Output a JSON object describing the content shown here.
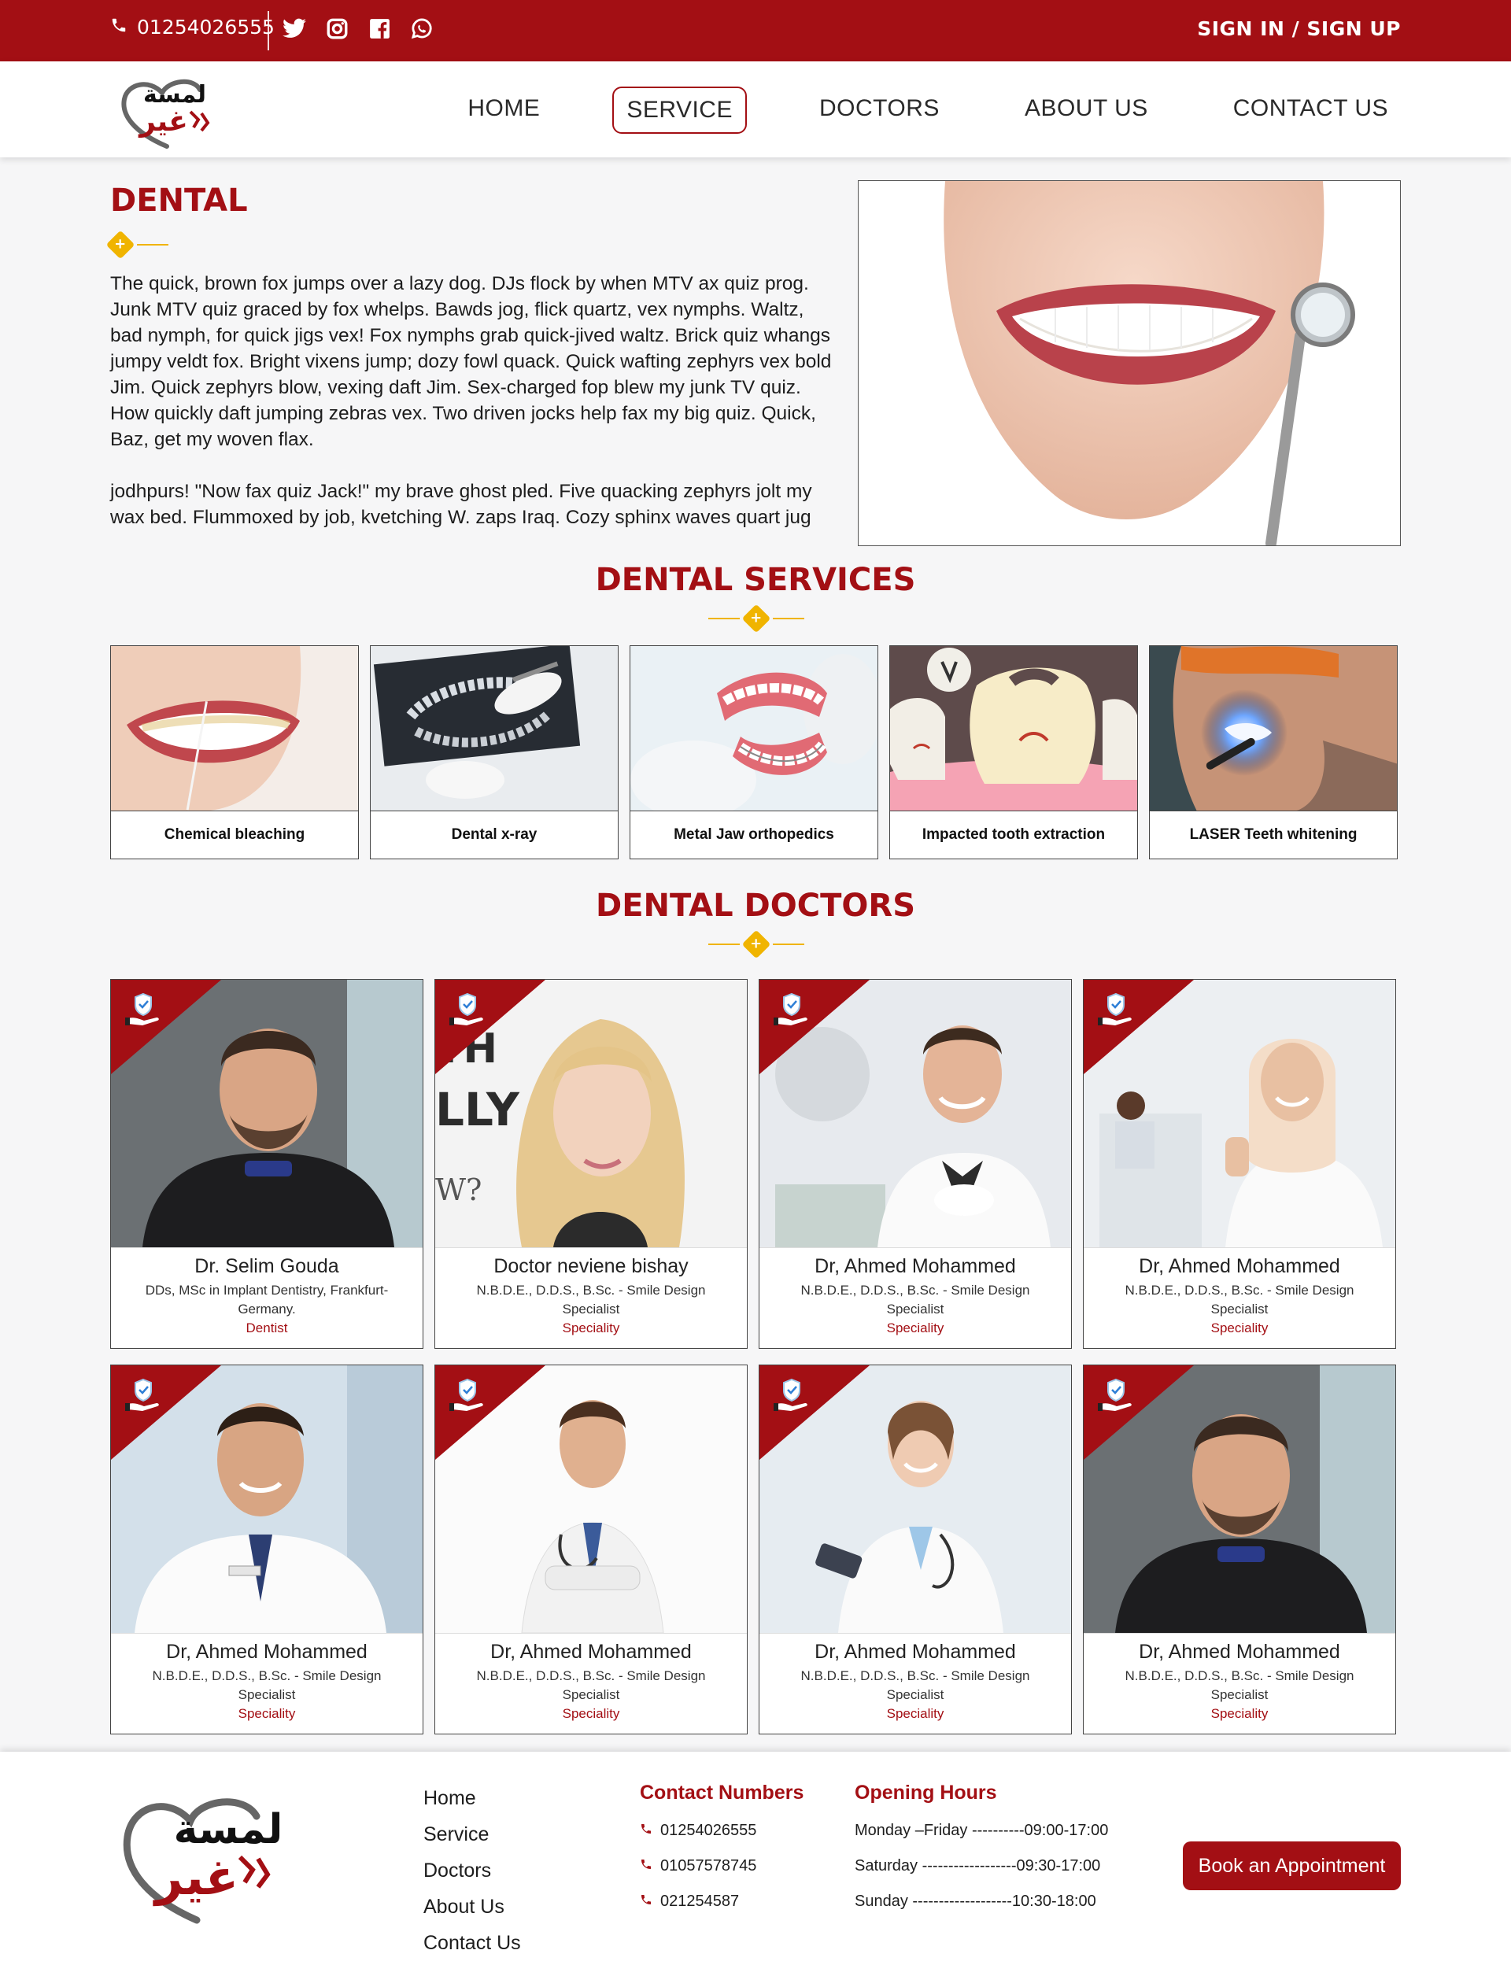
{
  "topbar": {
    "phone": "01254026555",
    "auth_label": "SIGN IN / SIGN UP",
    "socials": [
      "twitter-icon",
      "instagram-icon",
      "facebook-icon",
      "whatsapp-icon"
    ]
  },
  "nav": {
    "items": [
      {
        "label": "HOME",
        "active": false
      },
      {
        "label": "SERVICE",
        "active": true
      },
      {
        "label": "DOCTORS",
        "active": false
      },
      {
        "label": "ABOUT US",
        "active": false
      },
      {
        "label": "CONTACT US",
        "active": false
      }
    ]
  },
  "logo": {
    "text_line1": "لمسة",
    "text_line2": "غير"
  },
  "intro": {
    "title": "DENTAL",
    "paragraph1": "The quick, brown fox jumps over a lazy dog. DJs flock by when MTV ax quiz prog. Junk MTV quiz graced by fox whelps. Bawds jog, flick quartz, vex nymphs. Waltz, bad nymph, for quick jigs vex! Fox nymphs grab quick-jived waltz. Brick quiz whangs jumpy veldt fox. Bright vixens jump; dozy fowl quack. Quick wafting zephyrs vex bold Jim. Quick zephyrs blow, vexing daft Jim. Sex-charged fop blew my junk TV quiz. How quickly daft jumping zebras vex. Two driven jocks help fax my big quiz. Quick, Baz, get my woven flax.",
    "paragraph2": "jodhpurs! \"Now fax quiz Jack!\" my brave ghost pled. Five quacking zephyrs jolt my wax bed. Flummoxed by job, kvetching W. zaps Iraq. Cozy sphinx waves quart jug"
  },
  "services_section": {
    "title": "DENTAL SERVICES",
    "items": [
      {
        "label": "Chemical bleaching"
      },
      {
        "label": "Dental x-ray"
      },
      {
        "label": "Metal Jaw orthopedics"
      },
      {
        "label": "Impacted tooth extraction"
      },
      {
        "label": "LASER Teeth whitening"
      }
    ]
  },
  "doctors_section": {
    "title": "DENTAL DOCTORS",
    "items": [
      {
        "name": "Dr. Selim Gouda",
        "quals": "DDs, MSc in Implant Dentistry, Frankfurt- Germany.",
        "spec": "Dentist"
      },
      {
        "name": "Doctor neviene bishay",
        "quals": "N.B.D.E., D.D.S., B.Sc. - Smile Design Specialist",
        "spec": "Speciality"
      },
      {
        "name": "Dr, Ahmed Mohammed",
        "quals": "N.B.D.E., D.D.S., B.Sc. - Smile Design Specialist",
        "spec": "Speciality"
      },
      {
        "name": "Dr, Ahmed Mohammed",
        "quals": "N.B.D.E., D.D.S., B.Sc. - Smile Design Specialist",
        "spec": "Speciality"
      },
      {
        "name": "Dr, Ahmed Mohammed",
        "quals": "N.B.D.E., D.D.S., B.Sc. - Smile Design Specialist",
        "spec": "Speciality"
      },
      {
        "name": "Dr, Ahmed Mohammed",
        "quals": "N.B.D.E., D.D.S., B.Sc. - Smile Design Specialist",
        "spec": "Speciality"
      },
      {
        "name": "Dr, Ahmed Mohammed",
        "quals": "N.B.D.E., D.D.S., B.Sc. - Smile Design Specialist",
        "spec": "Speciality"
      },
      {
        "name": "Dr, Ahmed Mohammed",
        "quals": "N.B.D.E., D.D.S., B.Sc. - Smile Design Specialist",
        "spec": "Speciality"
      }
    ]
  },
  "footer": {
    "links": [
      "Home",
      "Service",
      "Doctors",
      "About Us",
      "Contact Us"
    ],
    "contact_title": "Contact Numbers",
    "phones": [
      "01254026555",
      "01057578745",
      "021254587"
    ],
    "hours_title": "Opening Hours",
    "hours": [
      "Monday –Friday ----------09:00-17:00",
      "Saturday ------------------09:30-17:00",
      "Sunday -------------------10:30-18:00"
    ],
    "book_label": "Book an Appointment"
  },
  "colors": {
    "brand": "#a30f14",
    "accent": "#f0b400",
    "background": "#f6f6f7"
  }
}
